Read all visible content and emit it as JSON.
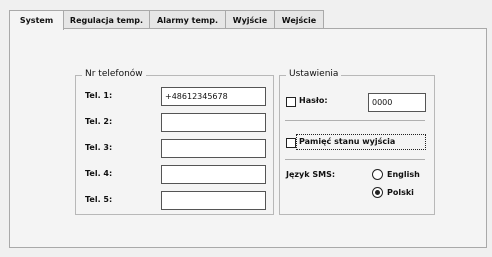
{
  "tabs": [
    {
      "label": "System",
      "active": true
    },
    {
      "label": "Regulacja temp.",
      "active": false
    },
    {
      "label": "Alarmy temp.",
      "active": false
    },
    {
      "label": "Wyjście",
      "active": false
    },
    {
      "label": "Wejście",
      "active": false
    }
  ],
  "phones": {
    "title": "Nr telefonów",
    "rows": [
      {
        "label": "Tel. 1:",
        "value": "+48612345678"
      },
      {
        "label": "Tel. 2:",
        "value": ""
      },
      {
        "label": "Tel. 3:",
        "value": ""
      },
      {
        "label": "Tel. 4:",
        "value": ""
      },
      {
        "label": "Tel. 5:",
        "value": ""
      }
    ]
  },
  "settings": {
    "title": "Ustawienia",
    "password": {
      "label": "Hasło:",
      "checked": false,
      "value": "0000"
    },
    "memory": {
      "label": "Pamięć stanu wyjścia",
      "checked": false
    },
    "sms_lang": {
      "label": "Język SMS:",
      "options": [
        {
          "label": "English",
          "selected": false
        },
        {
          "label": "Polski",
          "selected": true
        }
      ]
    }
  }
}
